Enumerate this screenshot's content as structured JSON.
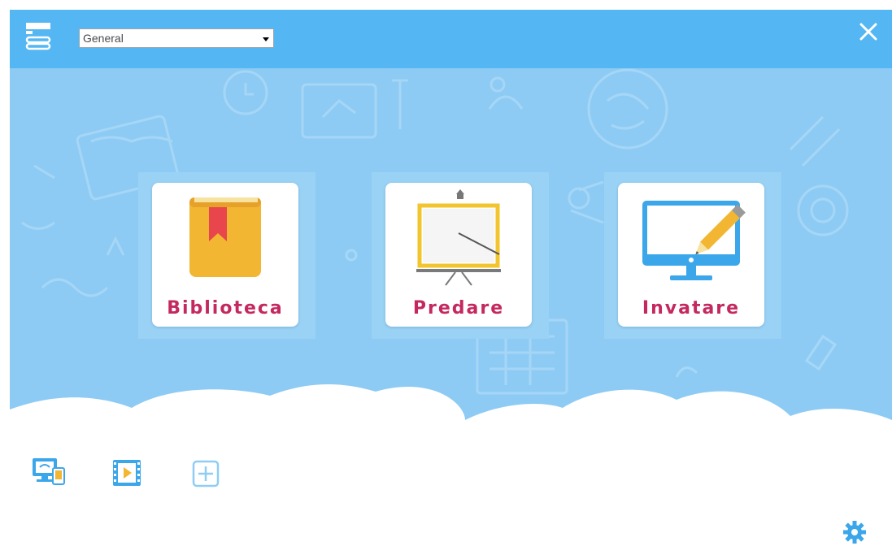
{
  "header": {
    "profile_select": {
      "value": "General"
    },
    "close_label": "✕"
  },
  "tiles": [
    {
      "label": "Biblioteca",
      "icon": "book-icon"
    },
    {
      "label": "Predare",
      "icon": "presentation-board-icon"
    },
    {
      "label": "Invatare",
      "icon": "monitor-pencil-icon"
    }
  ],
  "toolbar": {
    "icons": [
      "screen-share-icon",
      "video-play-icon",
      "add-icon"
    ]
  },
  "settings_icon": "gear-icon",
  "colors": {
    "titlebar": "#54b7f3",
    "background": "#8dcbf4",
    "label": "#c4285f",
    "icon_blue": "#3ba7ea"
  }
}
